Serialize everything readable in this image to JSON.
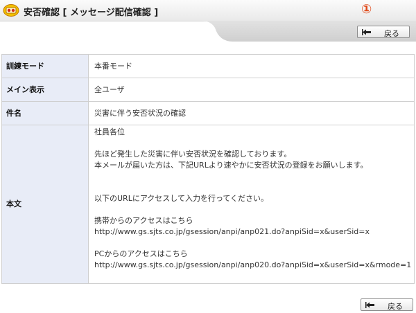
{
  "header": {
    "title": "安否確認 [ メッセージ配信確認 ]",
    "annotation": "①",
    "accent_color": "#e04a1a"
  },
  "buttons": {
    "back_label": "戻る"
  },
  "form": {
    "training_mode": {
      "label": "訓練モード",
      "value": "本番モード"
    },
    "main_display": {
      "label": "メイン表示",
      "value": "全ユーザ"
    },
    "subject": {
      "label": "件名",
      "value": "災害に伴う安否状況の確認"
    },
    "body": {
      "label": "本文",
      "lines": {
        "greeting": "社員各位",
        "intro1": "先ほど発生した災害に伴い安否状況を確認しております。",
        "intro2": "本メールが届いた方は、下記URLより速やかに安否状況の登録をお願いします。",
        "instruction": "以下のURLにアクセスして入力を行ってください。",
        "mobile_heading": "携帯からのアクセスはこちら",
        "mobile_url": "http://www.gs.sjts.co.jp/gsession/anpi/anp021.do?anpiSid=x&userSid=x",
        "pc_heading": "PCからのアクセスはこちら",
        "pc_url": "http://www.gs.sjts.co.jp/gsession/anpi/anp020.do?anpiSid=x&userSid=x&rmode=1"
      }
    }
  },
  "icons": {
    "app": "anpi-app-icon",
    "back": "back-arrow-icon"
  },
  "colors": {
    "label_bg": "#e8ecf7",
    "border": "#cfcfcf"
  }
}
